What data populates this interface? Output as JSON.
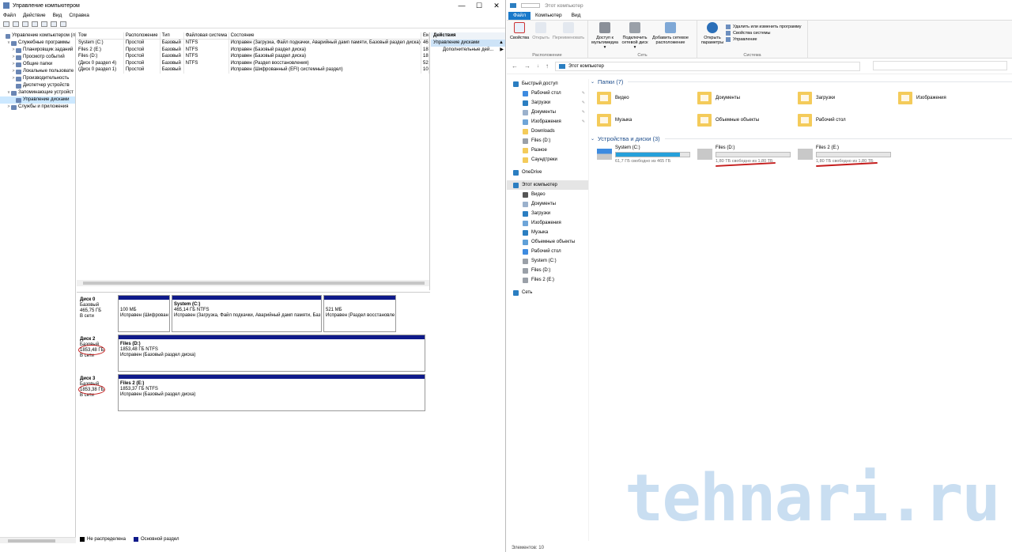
{
  "left_window": {
    "title": "Управление компьютером",
    "controls": [
      "—",
      "☐",
      "✕"
    ],
    "menu": [
      "Файл",
      "Действие",
      "Вид",
      "Справка"
    ],
    "tree": [
      {
        "label": "Управление компьютером (л",
        "indent": 0,
        "arrow": ""
      },
      {
        "label": "Служебные программы",
        "indent": 1,
        "arrow": "v"
      },
      {
        "label": "Планировщик заданий",
        "indent": 2,
        "arrow": ">"
      },
      {
        "label": "Просмотр событий",
        "indent": 2,
        "arrow": ">"
      },
      {
        "label": "Общие папки",
        "indent": 2,
        "arrow": ">"
      },
      {
        "label": "Локальные пользовате",
        "indent": 2,
        "arrow": ">"
      },
      {
        "label": "Производительность",
        "indent": 2,
        "arrow": ">"
      },
      {
        "label": "Диспетчер устройств",
        "indent": 2,
        "arrow": ""
      },
      {
        "label": "Запоминающие устройст",
        "indent": 1,
        "arrow": "v"
      },
      {
        "label": "Управление дисками",
        "indent": 2,
        "arrow": "",
        "selected": true
      },
      {
        "label": "Службы и приложения",
        "indent": 1,
        "arrow": ">"
      }
    ],
    "volume_columns": [
      "Том",
      "Расположение",
      "Тип",
      "Файловая система",
      "Состояние",
      "Ем"
    ],
    "volumes": [
      [
        "System (C:)",
        "Простой",
        "Базовый",
        "NTFS",
        "Исправен (Загрузка, Файл подкачки, Аварийный дамп памяти, Базовый раздел диска)",
        "46"
      ],
      [
        "Files 2 (E:)",
        "Простой",
        "Базовый",
        "NTFS",
        "Исправен (Базовый раздел диска)",
        "18"
      ],
      [
        "Files (D:)",
        "Простой",
        "Базовый",
        "NTFS",
        "Исправен (Базовый раздел диска)",
        "18"
      ],
      [
        "(Диск 0 раздел 4)",
        "Простой",
        "Базовый",
        "NTFS",
        "Исправен (Раздел восстановления)",
        "52"
      ],
      [
        "(Диск 0 раздел 1)",
        "Простой",
        "Базовый",
        "",
        "Исправен (Шифрованный (EFI) системный раздел)",
        "10"
      ]
    ],
    "disks": [
      {
        "name": "Диск 0",
        "type": "Базовый",
        "size": "465,75 ГБ",
        "state": "В сети",
        "partitions": [
          {
            "title": "",
            "size": "100 МБ",
            "status": "Исправен (Шифрован"
          },
          {
            "title": "System  (C:)",
            "size": "465,14 ГБ NTFS",
            "status": "Исправен (Загрузка, Файл подкачки, Аварийный дамп памяти, Баз"
          },
          {
            "title": "",
            "size": "521 МБ",
            "status": "Исправен (Раздел восстановле"
          }
        ]
      },
      {
        "name": "Диск 2",
        "type": "Базовый",
        "size": "1853,48 ГБ",
        "state": "В сети",
        "partitions": [
          {
            "title": "Files  (D:)",
            "size": "1853,48 ГБ NTFS",
            "status": "Исправен (Базовый раздел диска)"
          }
        ]
      },
      {
        "name": "Диск 3",
        "type": "Базовый",
        "size": "1853,38 ГБ",
        "state": "В сети",
        "partitions": [
          {
            "title": "Files 2  (E:)",
            "size": "1853,37 ГБ NTFS",
            "status": "Исправен (Базовый раздел диска)"
          }
        ]
      }
    ],
    "legend": [
      {
        "label": "Не распределена",
        "color": "#000000"
      },
      {
        "label": "Основной раздел",
        "color": "#0f1a8a"
      }
    ],
    "actions": {
      "header": "Действия",
      "selected": "Управление дисками",
      "item": "Дополнительные дей...",
      "selected_arrow": "▲",
      "item_arrow": "▶"
    }
  },
  "right_window": {
    "title": "Этот компьютер",
    "tabs": [
      "Файл",
      "Компьютер",
      "Вид"
    ],
    "ribbon": {
      "location": {
        "buttons": [
          "Свойства",
          "Открыть",
          "Переименовать"
        ],
        "label": "Расположение"
      },
      "network": {
        "buttons": [
          "Доступ к мультимедиа ▾",
          "Подключить сетевой диск ▾",
          "Добавить сетевое расположение"
        ],
        "label": "Сеть"
      },
      "system": {
        "big": "Открыть параметры",
        "small": [
          "Удалить или изменить программу",
          "Свойства системы",
          "Управление"
        ],
        "label": "Система"
      }
    },
    "address": {
      "path": "Этот компьютер",
      "nav": [
        "←",
        "→",
        "↓",
        "↑"
      ]
    },
    "nav_pane": [
      {
        "label": "Быстрый доступ",
        "icon": "star-icon",
        "pin": false,
        "top": true
      },
      {
        "label": "Рабочий стол",
        "icon": "desktop-icon",
        "pin": true
      },
      {
        "label": "Загрузки",
        "icon": "download-icon",
        "pin": true
      },
      {
        "label": "Документы",
        "icon": "document-icon",
        "pin": true
      },
      {
        "label": "Изображения",
        "icon": "pictures-icon",
        "pin": true
      },
      {
        "label": "Downloads",
        "icon": "folder-icon",
        "pin": false
      },
      {
        "label": "Files (D:)",
        "icon": "drive-icon",
        "pin": false
      },
      {
        "label": "Разное",
        "icon": "folder-icon",
        "pin": false
      },
      {
        "label": "Саундтреки",
        "icon": "folder-icon",
        "pin": false
      },
      {
        "label": "OneDrive",
        "icon": "onedrive-icon",
        "pin": false,
        "top": true
      },
      {
        "label": "Этот компьютер",
        "icon": "computer-icon",
        "pin": false,
        "top": true,
        "selected": true
      },
      {
        "label": "Видео",
        "icon": "video-icon",
        "pin": false
      },
      {
        "label": "Документы",
        "icon": "document-icon",
        "pin": false
      },
      {
        "label": "Загрузки",
        "icon": "download-icon",
        "pin": false
      },
      {
        "label": "Изображения",
        "icon": "pictures-icon",
        "pin": false
      },
      {
        "label": "Музыка",
        "icon": "music-icon",
        "pin": false
      },
      {
        "label": "Объемные объекты",
        "icon": "3d-objects-icon",
        "pin": false
      },
      {
        "label": "Рабочий стол",
        "icon": "desktop-icon",
        "pin": false
      },
      {
        "label": "System (C:)",
        "icon": "drive-icon",
        "pin": false
      },
      {
        "label": "Files (D:)",
        "icon": "drive-icon",
        "pin": false
      },
      {
        "label": "Files 2 (E:)",
        "icon": "drive-icon",
        "pin": false
      },
      {
        "label": "Сеть",
        "icon": "network-icon",
        "pin": false,
        "top": true
      }
    ],
    "folders_title": "Папки (7)",
    "folders": [
      "Видео",
      "Документы",
      "Загрузки",
      "Изображения",
      "Музыка",
      "Объемные объекты",
      "Рабочий стол"
    ],
    "drives_title": "Устройства и диски (3)",
    "drives": [
      {
        "name": "System (C:)",
        "free": "61,7 ГБ свободно из 465 ГБ",
        "used": 0.867
      },
      {
        "name": "Files (D:)",
        "free": "1,80 ТБ свободно из 1,80 ТБ",
        "used": 0.0
      },
      {
        "name": "Files 2 (E:)",
        "free": "1,80 ТБ свободно из 1,80 ТБ",
        "used": 0.0
      }
    ],
    "status": "Элементов: 10"
  },
  "watermark": "tehnari.ru",
  "colors": {
    "accent": "#1979ca",
    "partition_bar": "#0f1a8a",
    "annotation": "#c41c1c",
    "drive_bar": "#26a0da",
    "folder": "#f4cb5a"
  }
}
